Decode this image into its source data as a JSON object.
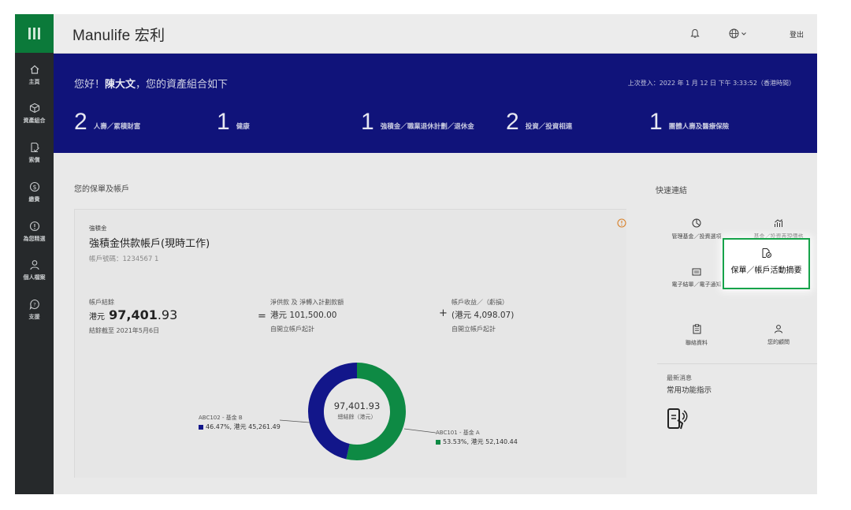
{
  "app": {
    "brand": "Manulife 宏利"
  },
  "sidebar": {
    "items": [
      {
        "label": "主頁",
        "icon": "home-icon"
      },
      {
        "label": "資產組合",
        "icon": "box-icon"
      },
      {
        "label": "索償",
        "icon": "claim-icon"
      },
      {
        "label": "繳費",
        "icon": "payment-icon"
      },
      {
        "label": "為您精選",
        "icon": "info-icon"
      },
      {
        "label": "個人檔案",
        "icon": "person-icon"
      },
      {
        "label": "支援",
        "icon": "support-icon"
      }
    ]
  },
  "header": {
    "logout_label": "登出"
  },
  "banner": {
    "greeting_prefix": "您好！",
    "user_name": "陳大文",
    "greeting_suffix": "，您的資產組合如下",
    "last_login": "上次登入：2022 年 1 月 12 日 下午 3:33:52（香港時間）",
    "stats": [
      {
        "count": "2",
        "label": "人壽／累積財富"
      },
      {
        "count": "1",
        "label": "健康"
      },
      {
        "count": "1",
        "label": "強積金／職業退休計劃／退休金"
      },
      {
        "count": "2",
        "label": "投資／投資相連"
      },
      {
        "count": "1",
        "label": "團體人壽及醫療保險"
      }
    ]
  },
  "main": {
    "section_title": "您的保單及帳戶",
    "account": {
      "type": "強積金",
      "name": "強積金供款帳戶(現時工作)",
      "number": "帳戶號碼：1234567 1",
      "balance_label": "帳戶結餘",
      "balance_currency": "港元",
      "balance_value": "97,401",
      "balance_decimals": ".93",
      "balance_date": "結餘截至 2021年5月6日",
      "equals": "=",
      "net_contrib_label": "淨供款 及 淨轉入計劃款額",
      "net_contrib_value": "港元 101,500.00",
      "net_contrib_sub": "自開立帳戶起計",
      "plus": "+",
      "gain_label": "帳戶收益／（虧損）",
      "gain_value": "(港元 4,098.07)",
      "gain_sub": "自開立帳戶起計"
    }
  },
  "chart_data": {
    "type": "pie",
    "center_value": "97,401.93",
    "center_label": "總結餘（港元）",
    "slices": [
      {
        "name": "ABC101 - 基金 A",
        "percent": 53.53,
        "value_label": "53.53%, 港元 52,140.44",
        "color": "#0e8a44"
      },
      {
        "name": "ABC102 - 基金 B",
        "percent": 46.47,
        "value_label": "46.47%, 港元 45,261.49",
        "color": "#12168a"
      }
    ]
  },
  "quick_links": {
    "title": "快速連結",
    "items": [
      {
        "label": "管理基金／投資選項",
        "icon": "pie-clock-icon"
      },
      {
        "label": "基金／投資表現價格",
        "icon": "growth-icon"
      },
      {
        "label": "電子結單／電子通知",
        "icon": "statement-icon"
      },
      {
        "label": "保單／帳戶活動摘要",
        "icon": "document-check-icon"
      },
      {
        "label": "聯絡資料",
        "icon": "clipboard-icon"
      },
      {
        "label": "您的顧問",
        "icon": "advisor-icon"
      }
    ]
  },
  "news": {
    "heading": "最新消息",
    "subheading": "常用功能指示"
  },
  "colors": {
    "brand_green": "#0b7a3a",
    "banner_blue": "#10137a",
    "highlight_border": "#16a34a"
  }
}
